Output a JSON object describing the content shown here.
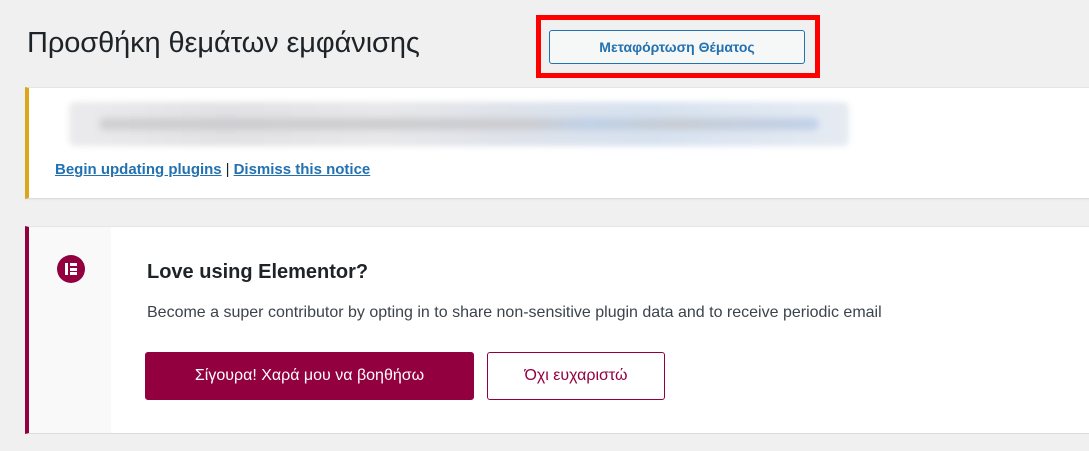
{
  "header": {
    "title": "Προσθήκη θεμάτων εμφάνισης",
    "upload_button": "Μεταφόρτωση Θέματος"
  },
  "update_notice": {
    "begin_link": "Begin updating plugins",
    "separator": "|",
    "dismiss_link": "Dismiss this notice",
    "accent_color": "#dba617"
  },
  "elementor_notice": {
    "title": "Love using Elementor?",
    "description": "Become a super contributor by opting in to share non-sensitive plugin data and to receive periodic email",
    "accept_button": "Σίγουρα! Χαρά μου να βοηθήσω",
    "decline_button": "Όχι ευχαριστώ",
    "icon": "elementor-logo-icon",
    "brand_color": "#93003f"
  },
  "highlight_color": "#ff0000"
}
